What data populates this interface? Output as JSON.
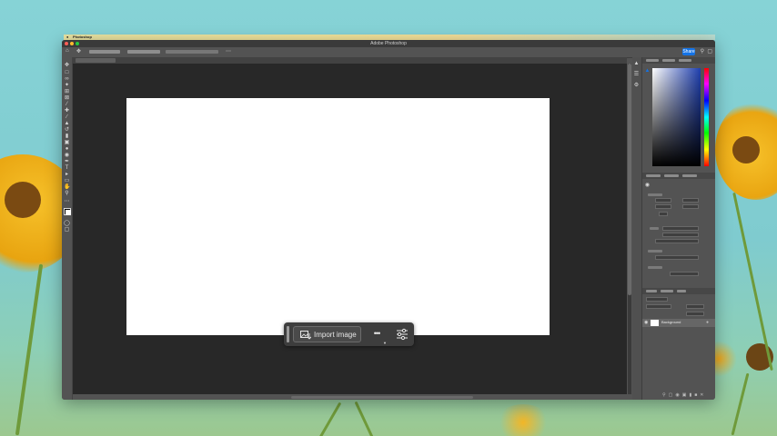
{
  "menubar": {
    "app_name": "Photoshop"
  },
  "window": {
    "title": "Adobe Photoshop"
  },
  "optionsbar": {
    "share_label": "Share"
  },
  "taskbar": {
    "import_label": "Import image",
    "more_label": "•••"
  },
  "layers": {
    "background_name": "Background"
  },
  "colors": {
    "accent": "#1473e6",
    "workspace": "#282828",
    "panel": "#535353",
    "document": "#ffffff"
  }
}
